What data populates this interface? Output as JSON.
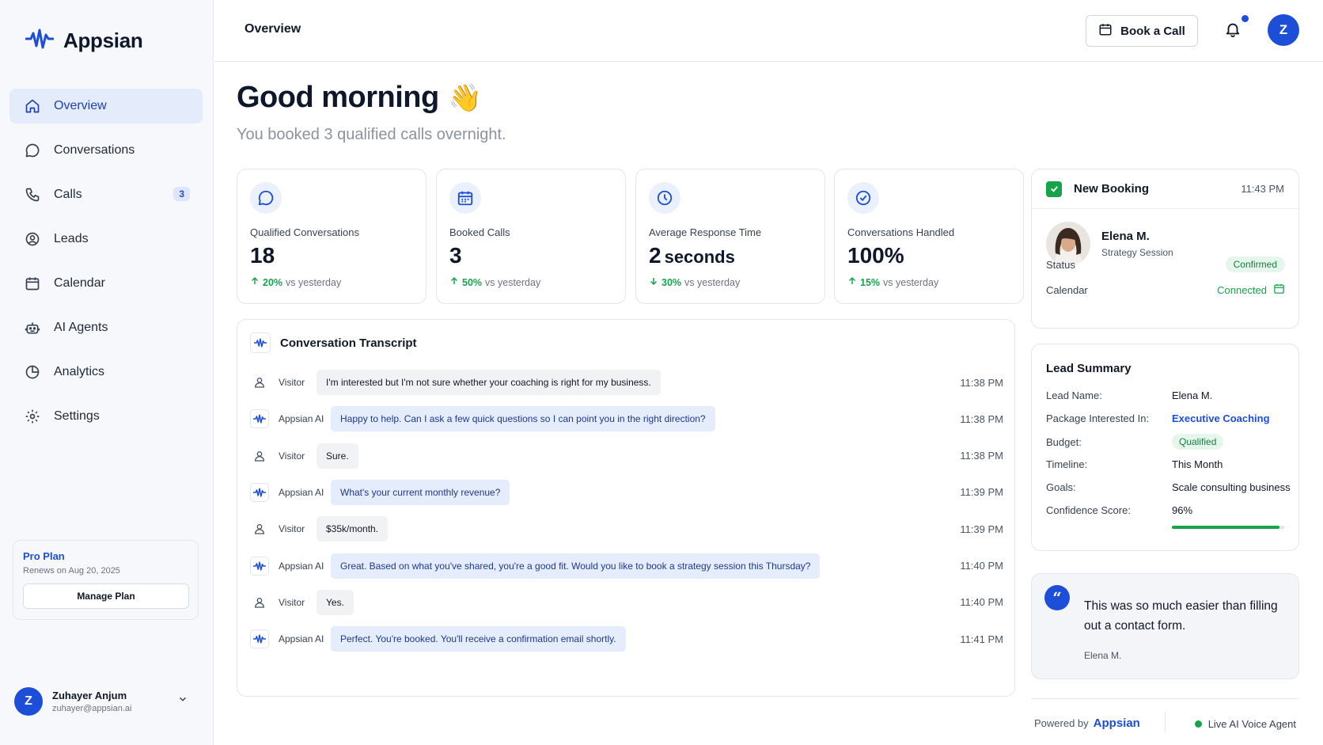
{
  "brand": {
    "name": "Appsian"
  },
  "sidebar": {
    "items": [
      {
        "label": "Overview",
        "icon": "home-icon",
        "active": true
      },
      {
        "label": "Conversations",
        "icon": "chat-icon"
      },
      {
        "label": "Calls",
        "icon": "phone-icon",
        "badge": "3"
      },
      {
        "label": "Leads",
        "icon": "user-circle-icon"
      },
      {
        "label": "Calendar",
        "icon": "calendar-icon"
      },
      {
        "label": "AI Agents",
        "icon": "robot-icon"
      },
      {
        "label": "Analytics",
        "icon": "pie-chart-icon"
      },
      {
        "label": "Settings",
        "icon": "gear-icon"
      }
    ],
    "plan": {
      "title": "Pro Plan",
      "renews": "Renews on Aug 20, 2025",
      "button": "Manage Plan"
    },
    "user": {
      "initial": "Z",
      "name": "Zuhayer Anjum",
      "email": "zuhayer@appsian.ai"
    }
  },
  "header": {
    "title": "Overview",
    "book_label": "Book a Call",
    "avatar_initial": "Z"
  },
  "greeting": {
    "title": "Good morning",
    "emoji": "👋",
    "subtitle": "You booked 3 qualified calls overnight."
  },
  "stats": [
    {
      "label": "Qualified Conversations",
      "value": "18",
      "unit": "",
      "delta": "20%",
      "delta_text": "vs yesterday",
      "direction": "up",
      "icon": "chat-icon"
    },
    {
      "label": "Booked Calls",
      "value": "3",
      "unit": "",
      "delta": "50%",
      "delta_text": "vs yesterday",
      "direction": "up",
      "icon": "calendar-icon"
    },
    {
      "label": "Average Response Time",
      "value": "2",
      "unit": "seconds",
      "delta": "30%",
      "delta_text": "vs yesterday",
      "direction": "down",
      "icon": "clock-icon"
    },
    {
      "label": "Conversations Handled",
      "value": "100%",
      "unit": "",
      "delta": "15%",
      "delta_text": "vs yesterday",
      "direction": "up",
      "icon": "check-circle-icon"
    }
  ],
  "transcript": {
    "title": "Conversation Transcript",
    "messages": [
      {
        "who": "Visitor",
        "text": "I'm interested but I'm not sure whether your coaching is right for my business.",
        "time": "11:38 PM",
        "ai": false
      },
      {
        "who": "Appsian AI",
        "text": "Happy to help. Can I ask a few quick questions so I can point you in the right direction?",
        "time": "11:38 PM",
        "ai": true
      },
      {
        "who": "Visitor",
        "text": "Sure.",
        "time": "11:38 PM",
        "ai": false
      },
      {
        "who": "Appsian AI",
        "text": "What's your current monthly revenue?",
        "time": "11:39 PM",
        "ai": true
      },
      {
        "who": "Visitor",
        "text": "$35k/month.",
        "time": "11:39 PM",
        "ai": false
      },
      {
        "who": "Appsian AI",
        "text": "Great. Based on what you've shared, you're a good fit. Would you like to book a strategy session this Thursday?",
        "time": "11:40 PM",
        "ai": true
      },
      {
        "who": "Visitor",
        "text": "Yes.",
        "time": "11:40 PM",
        "ai": false
      },
      {
        "who": "Appsian AI",
        "text": "Perfect. You're booked. You'll receive a confirmation email shortly.",
        "time": "11:41 PM",
        "ai": true
      }
    ]
  },
  "booking": {
    "title": "New Booking",
    "time": "11:43 PM",
    "name": "Elena M.",
    "session": "Strategy Session",
    "status_label": "Status",
    "status_value": "Confirmed",
    "calendar_label": "Calendar",
    "calendar_value": "Connected"
  },
  "lead": {
    "title": "Lead Summary",
    "rows": [
      {
        "k": "Lead Name:",
        "v": "Elena M."
      },
      {
        "k": "Package Interested In:",
        "v": "Executive Coaching"
      },
      {
        "k": "Budget:",
        "v": "Qualified"
      },
      {
        "k": "Timeline:",
        "v": "This Month"
      },
      {
        "k": "Goals:",
        "v": "Scale consulting business"
      },
      {
        "k": "Confidence Score:",
        "v": "96%"
      }
    ],
    "confidence": 0.96
  },
  "quote": {
    "mark": "“",
    "text": "This was so much easier than filling out a contact form.",
    "author": "Elena M."
  },
  "footer": {
    "powered_by": "Powered by",
    "brand": "Appsian",
    "live": "Live AI Voice Agent"
  },
  "colors": {
    "accent": "#1d4ed8",
    "success": "#16a34a",
    "active_bg": "#e4ebfb"
  }
}
